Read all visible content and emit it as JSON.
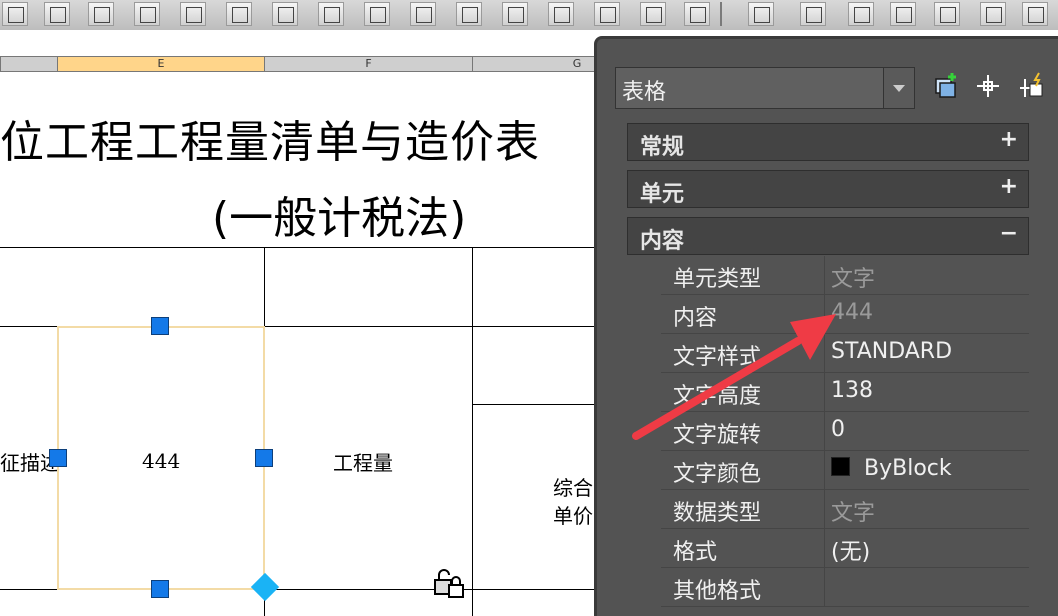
{
  "columns": [
    {
      "label": "",
      "selected": false
    },
    {
      "label": "E",
      "selected": true
    },
    {
      "label": "F",
      "selected": false
    },
    {
      "label": "G",
      "selected": false
    }
  ],
  "drawing": {
    "title_line1": "位工程工程量清单与造价表",
    "title_line2": "(一般计税法)",
    "cells": {
      "left_partial": "征描述",
      "selected_value": "444",
      "quantity": "工程量",
      "comp_line1": "综合",
      "comp_line2": "单价"
    }
  },
  "panel": {
    "object_type": "表格",
    "sections": [
      {
        "label": "常规",
        "toggle": "+"
      },
      {
        "label": "单元",
        "toggle": "+"
      },
      {
        "label": "内容",
        "toggle": "−"
      }
    ],
    "properties": [
      {
        "name": "单元类型",
        "value": "文字",
        "dim": true
      },
      {
        "name": "内容",
        "value": "444",
        "dim": true
      },
      {
        "name": "文字样式",
        "value": "STANDARD",
        "dim": false
      },
      {
        "name": "文字高度",
        "value": "138",
        "dim": false
      },
      {
        "name": "文字旋转",
        "value": "0",
        "dim": false
      },
      {
        "name": "文字颜色",
        "value": "ByBlock",
        "dim": false,
        "swatch": "#000000"
      },
      {
        "name": "数据类型",
        "value": "文字",
        "dim": true
      },
      {
        "name": "格式",
        "value": "(无)",
        "dim": false
      },
      {
        "name": "其他格式",
        "value": "",
        "dim": false
      }
    ]
  },
  "colors": {
    "accent_arrow": "#ef3b45",
    "grip": "#1479e8",
    "selection": "#f3dba6",
    "panel_bg": "#535353"
  }
}
